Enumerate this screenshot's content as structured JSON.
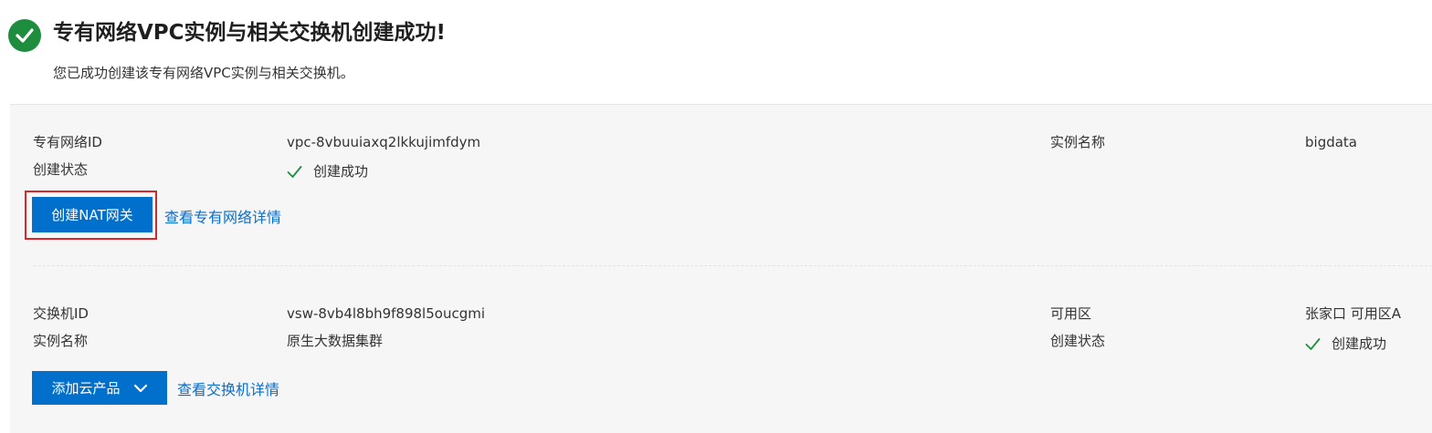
{
  "header": {
    "title": "专有网络VPC实例与相关交换机创建成功!",
    "subtitle": "您已成功创建该专有网络VPC实例与相关交换机。",
    "icon": "check-circle-icon",
    "icon_color": "#1e8e3e"
  },
  "vpc": {
    "id_label": "专有网络ID",
    "id_value": "vpc-8vbuuiaxq2lkkujimfdym",
    "status_label": "创建状态",
    "status_value": "创建成功",
    "name_label": "实例名称",
    "name_value": "bigdata",
    "create_nat_button": "创建NAT网关",
    "details_link": "查看专有网络详情"
  },
  "vswitch": {
    "id_label": "交换机ID",
    "id_value": "vsw-8vb4l8bh9f898l5oucgmi",
    "name_label": "实例名称",
    "name_value": "原生大数据集群",
    "zone_label": "可用区",
    "zone_value": "张家口 可用区A",
    "status_label": "创建状态",
    "status_value": "创建成功",
    "add_product_button": "添加云产品",
    "details_link": "查看交换机详情"
  },
  "colors": {
    "primary_button": "#0070cc",
    "link": "#0a6ecb",
    "success": "#1e8e3e",
    "highlight_box": "#d9262b"
  }
}
